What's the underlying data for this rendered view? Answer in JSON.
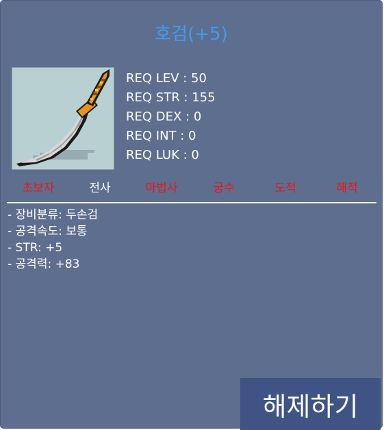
{
  "item": {
    "name": "호검(+5)",
    "name_color": "#3d9df2",
    "icon": "curved-sword-icon"
  },
  "requirements": [
    {
      "label": "REQ LEV : 50"
    },
    {
      "label": "REQ STR : 155"
    },
    {
      "label": "REQ DEX : 0"
    },
    {
      "label": "REQ INT : 0"
    },
    {
      "label": "REQ LUK : 0"
    }
  ],
  "jobs": [
    {
      "label": "초보자",
      "status": "fail"
    },
    {
      "label": "전사",
      "status": "ok"
    },
    {
      "label": "마법사",
      "status": "fail"
    },
    {
      "label": "궁수",
      "status": "fail"
    },
    {
      "label": "도적",
      "status": "fail"
    },
    {
      "label": "해적",
      "status": "fail"
    }
  ],
  "stats": [
    "- 장비분류: 두손검",
    "- 공격속도: 보통",
    "- STR: +5",
    "- 공격력: +83"
  ],
  "colors": {
    "panel_bg": "#5e6e8e",
    "job_fail": "#e8151b",
    "job_ok": "#ffffff",
    "button_bg": "#3f5484"
  },
  "actions": {
    "release_label": "해제하기"
  }
}
